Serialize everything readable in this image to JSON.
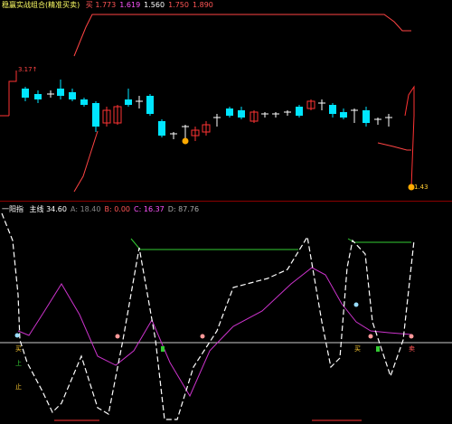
{
  "top_panel": {
    "header": {
      "title": "稳赢实战组合(精准买卖)",
      "items": [
        {
          "label": "买",
          "value": "1.773",
          "color": "#ff5555"
        },
        {
          "label": "",
          "value": "1.619",
          "color": "#ff55ff"
        },
        {
          "label": "",
          "value": "1.560",
          "color": "#ffffff"
        },
        {
          "label": "",
          "value": "1.750",
          "color": "#ff5555"
        },
        {
          "label": "",
          "value": "1.890",
          "color": "#ff5555"
        }
      ]
    },
    "price_label_high": "3.17↑",
    "price_label_low": "1.43",
    "colors": {
      "up": "#ff3333",
      "down": "#00e5ff",
      "flat": "#ffffff",
      "line": "#ff4444"
    }
  },
  "bottom_panel": {
    "header": {
      "title": "一阳指",
      "items": [
        {
          "label": "主线",
          "value": "34.60",
          "color": "#ffffff"
        },
        {
          "label": "A:",
          "value": "18.40",
          "color": "#888888"
        },
        {
          "label": "B:",
          "value": "0.00",
          "color": "#ff5555"
        },
        {
          "label": "C:",
          "value": "16.37",
          "color": "#ff55ff"
        },
        {
          "label": "D:",
          "value": "87.76",
          "color": "#aaaaaa"
        }
      ]
    },
    "tags": {
      "buy": "买",
      "sell": "卖",
      "up": "上",
      "stop": "止"
    },
    "colors": {
      "main": "#ffffff",
      "signal": "#cc33cc",
      "resist": "#33cc33",
      "base": "#cccccc"
    }
  }
}
